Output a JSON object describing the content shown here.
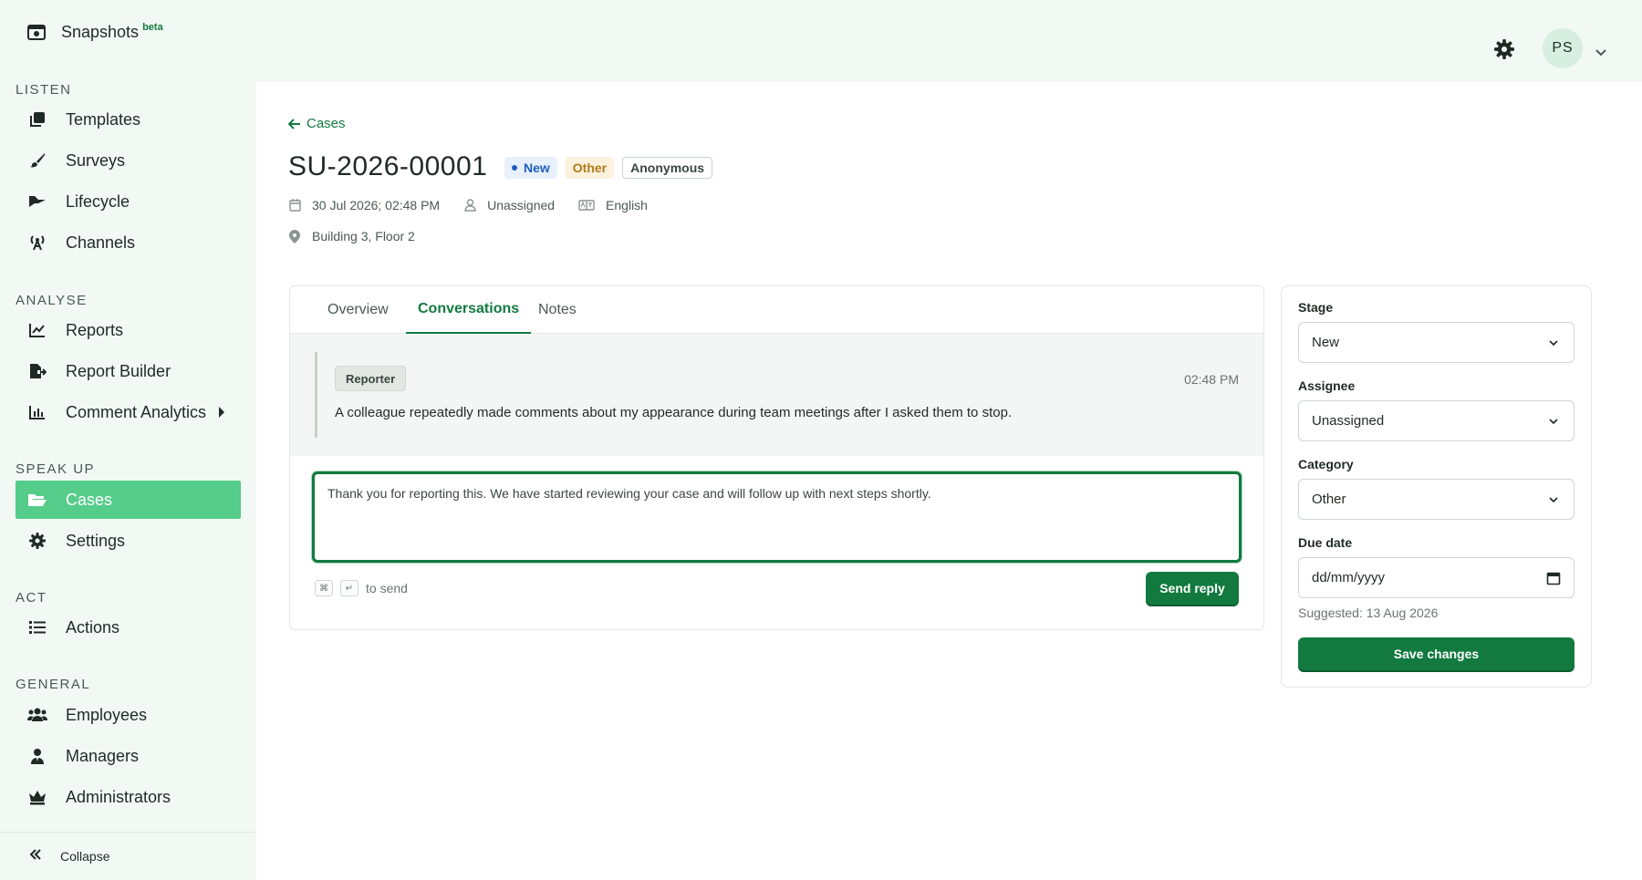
{
  "sidebar": {
    "brand": {
      "label": "Snapshots",
      "badge": "beta"
    },
    "sections": {
      "listen": "LISTEN",
      "analyse": "ANALYSE",
      "speak_up": "SPEAK UP",
      "act": "ACT",
      "general": "GENERAL"
    },
    "items": {
      "templates": "Templates",
      "surveys": "Surveys",
      "lifecycle": "Lifecycle",
      "channels": "Channels",
      "reports": "Reports",
      "report_builder": "Report Builder",
      "comment_analytics": "Comment Analytics",
      "cases": "Cases",
      "settings": "Settings",
      "actions": "Actions",
      "employees": "Employees",
      "managers": "Managers",
      "administrators": "Administrators"
    },
    "collapse": "Collapse"
  },
  "topbar": {
    "avatar_initials": "PS"
  },
  "case": {
    "back_label": "Cases",
    "id": "SU-2026-00001",
    "badges": {
      "status": "New",
      "category": "Other",
      "anonymity": "Anonymous"
    },
    "datetime": "30 Jul 2026; 02:48 PM",
    "assignee": "Unassigned",
    "language": "English",
    "location": "Building 3, Floor 2"
  },
  "tabs": {
    "overview": "Overview",
    "conversations": "Conversations",
    "notes": "Notes"
  },
  "conversation": {
    "sender": "Reporter",
    "time": "02:48 PM",
    "message": "A colleague repeatedly made comments about my appearance during team meetings after I asked them to stop.",
    "reply_value": "Thank you for reporting this. We have started reviewing your case and will follow up with next steps shortly.",
    "kbd_cmd": "⌘",
    "kbd_enter": "↵",
    "to_send": "to send",
    "send_label": "Send reply"
  },
  "panel": {
    "stage_label": "Stage",
    "stage_value": "New",
    "assignee_label": "Assignee",
    "assignee_value": "Unassigned",
    "category_label": "Category",
    "category_value": "Other",
    "due_label": "Due date",
    "due_placeholder": "dd/mm/yyyy",
    "suggested": "Suggested: 13 Aug 2026",
    "save_label": "Save changes"
  },
  "colors": {
    "brand_green": "#127a3f",
    "active_nav": "#56cc8a",
    "sidebar_bg": "#f2f9f4"
  }
}
